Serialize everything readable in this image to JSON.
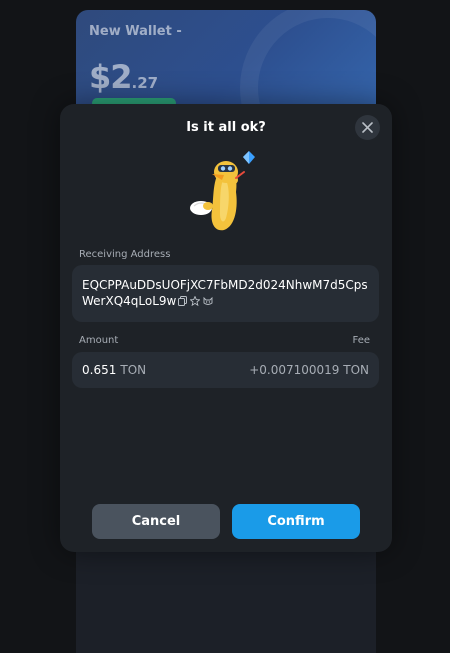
{
  "wallet_card": {
    "title": "New Wallet -",
    "balance_whole": "$2",
    "balance_cents": ".27"
  },
  "modal": {
    "title": "Is it all ok?",
    "receiving_address_label": "Receiving Address",
    "receiving_address": "EQCPPAuDDsUOFjXC7FbMD2d024NhwM7d5CpsWerXQ4qLoL9w",
    "amount_label": "Amount",
    "fee_label": "Fee",
    "amount_value": "0.651",
    "amount_unit": "TON",
    "fee_value": "+0.007100019 TON",
    "cancel_label": "Cancel",
    "confirm_label": "Confirm"
  },
  "icons": {
    "close": "close-icon",
    "copy": "copy-icon",
    "star": "star-icon",
    "explorer": "explorer-icon",
    "sticker": "duck-sticker",
    "gem": "diamond-icon"
  },
  "colors": {
    "background": "#121417",
    "modal": "#1e2227",
    "field": "#272d35",
    "confirm": "#1a9be8",
    "cancel": "#4a535e"
  }
}
